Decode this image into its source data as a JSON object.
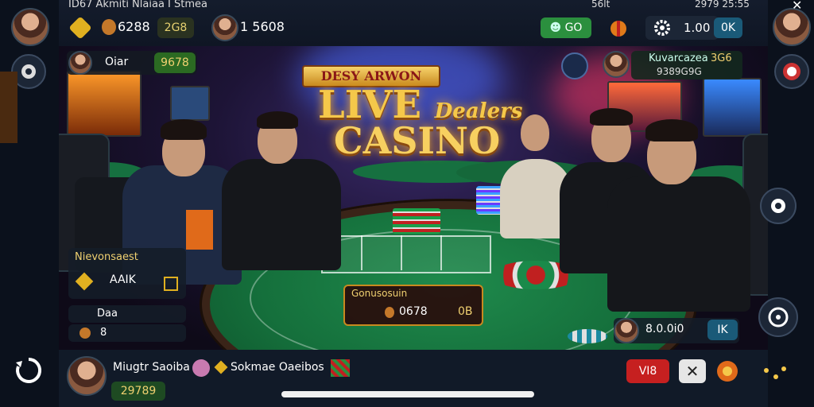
{
  "status_bar": {
    "left_text": "ID67 Akmiti Nlaiaa I Stmea",
    "right_text_1": "56lt",
    "right_text_2": "2979 25:55"
  },
  "top_bar": {
    "coins": "6288",
    "gems": "2G8",
    "player_count": "1 5608",
    "cash_label": "GO",
    "settings_value": "1.00",
    "ok_label": "0K"
  },
  "player_card_left": {
    "name": "Oiar",
    "balance": "9678"
  },
  "player_card_right": {
    "title": "Kuvarcazea",
    "amount": "3G6",
    "sub": "9389G9G"
  },
  "logo": {
    "banner": "DESY ARWON",
    "line1": "LIVE",
    "line1_script": "Dealers",
    "line2": "CASINO"
  },
  "side_panel": {
    "title": "Nievonsaest",
    "item_label": "AAIK",
    "row2_label": "Daa",
    "row3_label": "8"
  },
  "bet_panel": {
    "title": "Gonusosuin",
    "value": "0678",
    "ok_label": "0B"
  },
  "right_balance": {
    "value": "8.0.0i0",
    "button": "IK"
  },
  "bottom_bar": {
    "player_name": "Miugtr Saoiba",
    "partner_name": "Sokmae Oaeibos",
    "balance": "29789",
    "stop_label": "VI8"
  },
  "colors": {
    "accent_gold": "#f5c84a",
    "accent_green": "#2b8f3e",
    "accent_red": "#c62020",
    "accent_blue": "#1a5a78"
  }
}
